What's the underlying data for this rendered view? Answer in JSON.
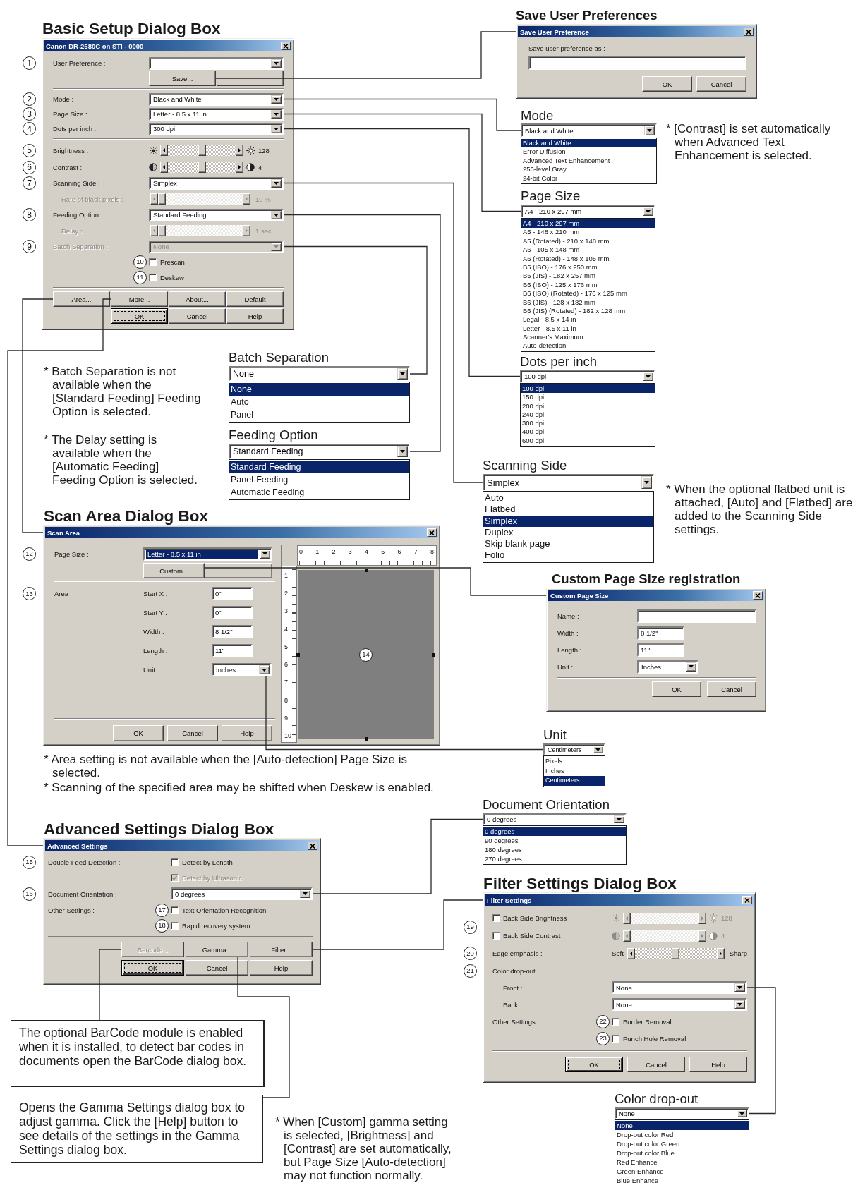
{
  "basic_setup": {
    "heading": "Basic Setup Dialog Box",
    "title": "Canon DR-2580C on STI - 0000",
    "rows": [
      {
        "kind": "combo",
        "callout": "1",
        "label": "User Preference :",
        "disabled": false
      },
      {
        "kind": "control_buttons",
        "buttons": [
          {
            "label": "Save...",
            "focused": false
          },
          {
            "focused": false
          }
        ]
      },
      {
        "kind": "separator"
      },
      {
        "kind": "combo",
        "callout": "2",
        "label": "Mode :",
        "value": "Black and White",
        "disabled": false
      },
      {
        "kind": "combo",
        "callout": "3",
        "label": "Page Size :",
        "value": "Letter - 8.5 x 11 in",
        "disabled": false
      },
      {
        "kind": "combo",
        "callout": "4",
        "label": "Dots per inch :",
        "value": "300 dpi",
        "disabled": false
      },
      {
        "kind": "separator"
      },
      {
        "kind": "brightness",
        "callout": "5",
        "label": "Brightness :",
        "level": 0.5,
        "reading": "128",
        "disabled": false
      },
      {
        "kind": "contrast",
        "callout": "6",
        "label": "Contrast :",
        "level": 0.5,
        "reading": "4",
        "disabled": false
      },
      {
        "kind": "combo",
        "callout": "7",
        "label": "Scanning Side :",
        "value": "Simplex",
        "disabled": false,
        "children": [
          {
            "kind": "slider",
            "label": "Rate of black pixels :",
            "level": 0,
            "reading": "10 %",
            "disabled": true
          }
        ]
      },
      {
        "kind": "combo",
        "callout": "8",
        "label": "Feeding Option :",
        "value": "Standard Feeding",
        "disabled": false,
        "children": [
          {
            "kind": "slider",
            "label": "Delay :",
            "level": 0,
            "reading": "1 sec",
            "disabled": true
          }
        ]
      },
      {
        "kind": "combo",
        "callout": "9",
        "label": "Batch Separation :",
        "value": "None",
        "disabled": true
      },
      {
        "kind": "checkbox",
        "inline_callout": "10",
        "text": "Prescan",
        "checked": false,
        "disabled": false
      },
      {
        "kind": "checkbox",
        "inline_callout": "11",
        "text": "Deskew",
        "checked": false,
        "disabled": false
      },
      {
        "kind": "separator"
      },
      {
        "kind": "buttons",
        "buttons": [
          {
            "label": "Area...",
            "focused": false,
            "disabled": false
          },
          {
            "label": "More...",
            "focused": false,
            "disabled": false
          },
          {
            "label": "About...",
            "focused": false,
            "disabled": false
          },
          {
            "label": "Default",
            "focused": false,
            "disabled": false
          }
        ]
      },
      {
        "kind": "buttons",
        "buttons": [
          {
            "label": "OK",
            "focused": true,
            "disabled": false
          },
          {
            "label": "Cancel",
            "focused": false,
            "disabled": false
          },
          {
            "label": "Help",
            "focused": false,
            "disabled": false
          }
        ]
      }
    ]
  },
  "save_preferences": {
    "heading": "Save User Preferences",
    "title": "Save User Preference",
    "label": "Save user preference as :",
    "buttons": [
      {
        "label": "OK",
        "focused": false,
        "disabled": false
      },
      {
        "label": "Cancel",
        "focused": false,
        "disabled": false
      }
    ]
  },
  "mode_list": {
    "heading": "Mode",
    "value": "Black and White",
    "options": [
      {
        "label": "Black and White",
        "selected": true
      },
      {
        "label": "Error Diffusion",
        "selected": false
      },
      {
        "label": "Advanced Text Enhancement",
        "selected": false
      },
      {
        "label": "256-level Gray",
        "selected": false
      },
      {
        "label": "24-bit Color",
        "selected": false
      }
    ]
  },
  "contrast_note": "* [Contrast] is set automatically when Advanced Text Enhancement is selected.",
  "page_size_list": {
    "heading": "Page Size",
    "value": "A4 - 210 x 297 mm",
    "options": [
      {
        "label": "A4 - 210 x 297 mm",
        "selected": true
      },
      {
        "label": "A5 - 148 x 210 mm",
        "selected": false
      },
      {
        "label": "A5 (Rotated) - 210 x 148 mm",
        "selected": false
      },
      {
        "label": "A6 - 105 x 148 mm",
        "selected": false
      },
      {
        "label": "A6 (Rotated) - 148 x 105 mm",
        "selected": false
      },
      {
        "label": "B5 (ISO) - 176 x 250 mm",
        "selected": false
      },
      {
        "label": "B5 (JIS) - 182 x 257 mm",
        "selected": false
      },
      {
        "label": "B6 (ISO) - 125 x 176 mm",
        "selected": false
      },
      {
        "label": "B6 (ISO) (Rotated) - 176 x 125 mm",
        "selected": false
      },
      {
        "label": "B6 (JIS) - 128 x 182 mm",
        "selected": false
      },
      {
        "label": "B6 (JIS) (Rotated) - 182 x 128 mm",
        "selected": false
      },
      {
        "label": "Legal - 8.5 x 14 in",
        "selected": false
      },
      {
        "label": "Letter - 8.5 x 11 in",
        "selected": false
      },
      {
        "label": "Scanner's Maximum",
        "selected": false
      },
      {
        "label": "Auto-detection",
        "selected": false
      }
    ]
  },
  "dpi_list": {
    "heading": "Dots per inch",
    "value": "100 dpi",
    "options": [
      {
        "label": "100 dpi",
        "selected": true
      },
      {
        "label": "150 dpi",
        "selected": false
      },
      {
        "label": "200 dpi",
        "selected": false
      },
      {
        "label": "240 dpi",
        "selected": false
      },
      {
        "label": "300 dpi",
        "selected": false
      },
      {
        "label": "400 dpi",
        "selected": false
      },
      {
        "label": "600 dpi",
        "selected": false
      }
    ]
  },
  "batch_note": "* Batch Separation is not available when the [Standard Feeding] Feeding Option is selected.",
  "delay_note": "* The Delay setting is available when the [Automatic Feeding] Feeding Option is selected.",
  "batch_separation_list": {
    "heading": "Batch Separation",
    "value": "None",
    "options": [
      {
        "label": "None",
        "selected": true
      },
      {
        "label": "Auto",
        "selected": false
      },
      {
        "label": "Panel",
        "selected": false
      }
    ]
  },
  "feeding_option_list": {
    "heading": "Feeding Option",
    "value": "Standard Feeding",
    "options": [
      {
        "label": "Standard Feeding",
        "selected": true
      },
      {
        "label": "Panel-Feeding",
        "selected": false
      },
      {
        "label": "Automatic Feeding",
        "selected": false
      }
    ]
  },
  "scanning_side_list": {
    "heading": "Scanning Side",
    "value": "Simplex",
    "options": [
      {
        "label": "Auto",
        "selected": false
      },
      {
        "label": "Flatbed",
        "selected": false
      },
      {
        "label": "Simplex",
        "selected": true
      },
      {
        "label": "Duplex",
        "selected": false
      },
      {
        "label": "Skip blank page",
        "selected": false
      },
      {
        "label": "Folio",
        "selected": false
      }
    ]
  },
  "flatbed_note": "* When the optional flatbed unit is attached, [Auto] and [Flatbed] are added to the Scanning Side settings.",
  "scan_area": {
    "heading": "Scan Area Dialog Box",
    "title": "Scan Area",
    "page_size": {
      "callout": "12",
      "label": "Page Size :",
      "value": "Letter - 8.5 x 11 in",
      "focused": true
    },
    "page_buttons": [
      {
        "label": "Custom...",
        "focused": false
      },
      {
        "focused": false
      }
    ],
    "area": {
      "callout": "13",
      "label": "Area",
      "fields": [
        {
          "kind": "input",
          "label": "Start X :",
          "value": "0\""
        },
        {
          "kind": "input",
          "label": "Start Y :",
          "value": "0\""
        },
        {
          "kind": "input",
          "label": "Width :",
          "value": "8 1/2\""
        },
        {
          "kind": "input",
          "label": "Length :",
          "value": "11\""
        },
        {
          "kind": "combo",
          "label": "Unit :",
          "value": "Inches"
        }
      ]
    },
    "buttons": [
      {
        "label": "OK",
        "focused": false,
        "disabled": false
      },
      {
        "label": "Cancel",
        "focused": false,
        "disabled": false
      },
      {
        "label": "Help",
        "focused": false,
        "disabled": false
      }
    ],
    "preview": {
      "callout": "14",
      "top_ruler": [
        "0",
        "1",
        "2",
        "3",
        "4",
        "5",
        "6",
        "7",
        "8"
      ],
      "side_ruler": [
        "1",
        "2",
        "3",
        "4",
        "5",
        "6",
        "7",
        "8",
        "9",
        "10"
      ]
    }
  },
  "custom_page_size": {
    "heading": "Custom Page Size registration",
    "title": "Custom Page Size",
    "fields": [
      {
        "kind": "text",
        "label": "Name :"
      },
      {
        "kind": "measure",
        "label": "Width :",
        "value": "8 1/2\""
      },
      {
        "kind": "measure",
        "label": "Length :",
        "value": "11\""
      },
      {
        "kind": "combo",
        "label": "Unit :",
        "value": "Inches"
      }
    ],
    "buttons": [
      {
        "label": "OK",
        "focused": false,
        "disabled": false
      },
      {
        "label": "Cancel",
        "focused": false,
        "disabled": false
      }
    ]
  },
  "unit_list": {
    "heading": "Unit",
    "value": "Centimeters",
    "options": [
      {
        "label": "Pixels",
        "selected": false
      },
      {
        "label": "Inches",
        "selected": false
      },
      {
        "label": "Centimeters",
        "selected": true
      }
    ]
  },
  "area_notes": [
    "* Area setting is not available when the [Auto-detection] Page Size is selected.",
    "* Scanning of the specified area may be shifted when Deskew is enabled."
  ],
  "document_orientation_list": {
    "heading": "Document Orientation",
    "value": "0 degrees",
    "options": [
      {
        "label": "0 degrees",
        "selected": true
      },
      {
        "label": "90 degrees",
        "selected": false
      },
      {
        "label": "180 degrees",
        "selected": false
      },
      {
        "label": "270 degrees",
        "selected": false
      }
    ]
  },
  "advanced_settings": {
    "heading": "Advanced Settings Dialog Box",
    "title": "Advanced Settings",
    "rows": [
      {
        "kind": "checkbox",
        "callout": "15",
        "label": "Double Feed Detection :",
        "text": "Detect by Length",
        "checked": false,
        "disabled": false
      },
      {
        "kind": "checkbox",
        "text": "Detect by Ultrasonic",
        "checked": true,
        "disabled": true
      },
      {
        "kind": "combo",
        "callout": "16",
        "label": "Document Orientation :",
        "value": "0 degrees",
        "disabled": false
      },
      {
        "kind": "checkbox",
        "label": "Other Settings :",
        "inline_callout": "17",
        "text": "Text Orientation Recognition",
        "checked": false,
        "disabled": false
      },
      {
        "kind": "checkbox",
        "inline_callout": "18",
        "text": "Rapid recovery system",
        "checked": false,
        "disabled": false
      },
      {
        "kind": "separator"
      },
      {
        "kind": "buttons",
        "buttons": [
          {
            "label": "Barcode...",
            "focused": false,
            "disabled": true
          },
          {
            "label": "Gamma...",
            "focused": false,
            "disabled": false
          },
          {
            "label": "Filter...",
            "focused": false,
            "disabled": false
          }
        ]
      },
      {
        "kind": "buttons",
        "buttons": [
          {
            "label": "OK",
            "focused": true,
            "disabled": false
          },
          {
            "label": "Cancel",
            "focused": false,
            "disabled": false
          },
          {
            "label": "Help",
            "focused": false,
            "disabled": false
          }
        ]
      }
    ]
  },
  "filter_settings": {
    "heading": "Filter Settings Dialog Box",
    "title": "Filter Settings",
    "rows": [
      {
        "kind": "group",
        "callout": "19",
        "rows": [
          {
            "kind": "brightness",
            "label": "Back Side Brightness",
            "checked": false,
            "reading": "128",
            "disabled": true
          },
          {
            "kind": "contrast",
            "label": "Back Side Contrast",
            "checked": false,
            "reading": "4",
            "disabled": true
          }
        ]
      },
      {
        "kind": "range",
        "callout": "20",
        "label": "Edge emphasis :",
        "low": "Soft",
        "high": "Sharp",
        "level": 0.5,
        "disabled": false
      },
      {
        "kind": "label",
        "callout": "21",
        "label": "Color drop-out",
        "children": [
          {
            "kind": "combo",
            "label": "Front :",
            "value": "None",
            "disabled": false
          },
          {
            "kind": "combo",
            "label": "Back :",
            "value": "None",
            "disabled": false
          }
        ]
      },
      {
        "kind": "checkbox",
        "label": "Other Settings :",
        "inline_callout": "22",
        "text": "Border Removal",
        "checked": false,
        "disabled": false
      },
      {
        "kind": "checkbox",
        "inline_callout": "23",
        "text": "Punch Hole Removal",
        "checked": false,
        "disabled": false
      },
      {
        "kind": "separator"
      },
      {
        "kind": "buttons",
        "buttons": [
          {
            "label": "OK",
            "focused": true,
            "disabled": false
          },
          {
            "label": "Cancel",
            "focused": false,
            "disabled": false
          },
          {
            "label": "Help",
            "focused": false,
            "disabled": false
          }
        ]
      }
    ]
  },
  "barcode_note": "The optional BarCode module is enabled when it is installed, to detect bar codes in documents open the BarCode dialog box.",
  "gamma_note": "Opens the Gamma Settings dialog box to adjust gamma. Click the [Help] button to see details of the settings in the Gamma Settings dialog box.",
  "custom_gamma_note": "* When [Custom] gamma setting is selected, [Brightness] and [Contrast] are set automatically, but Page Size [Auto-detection] may not function normally.",
  "color_dropout_list": {
    "heading": "Color drop-out",
    "value": "None",
    "options": [
      {
        "label": "None",
        "selected": true
      },
      {
        "label": "Drop-out color Red",
        "selected": false
      },
      {
        "label": "Drop-out color Green",
        "selected": false
      },
      {
        "label": "Drop-out color Blue",
        "selected": false
      },
      {
        "label": "Red Enhance",
        "selected": false
      },
      {
        "label": "Green Enhance",
        "selected": false
      },
      {
        "label": "Blue Enhance",
        "selected": false
      }
    ]
  }
}
